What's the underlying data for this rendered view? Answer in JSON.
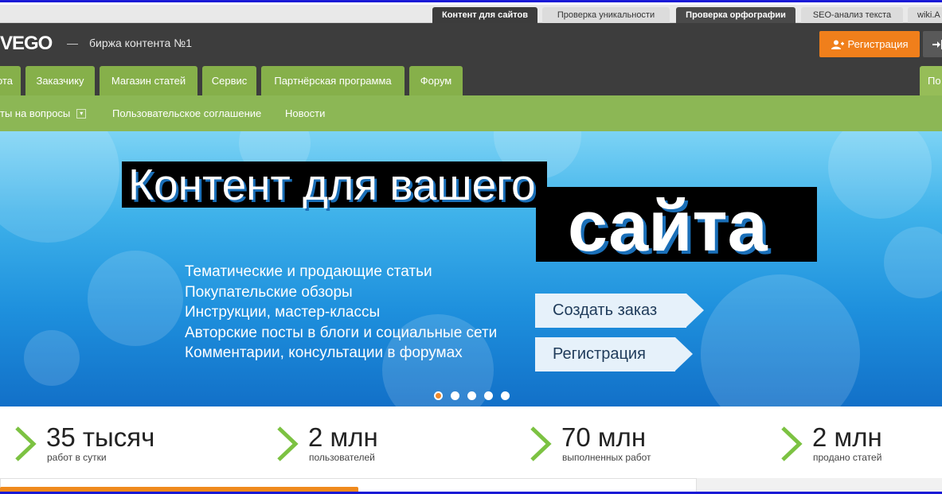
{
  "service_tabs": [
    {
      "label": "Контент для сайтов"
    },
    {
      "label": "Проверка уникальности"
    },
    {
      "label": "Проверка орфографии"
    },
    {
      "label": "SEO-анализ текста"
    },
    {
      "label": "wiki.A"
    }
  ],
  "header": {
    "logo": "VEGO",
    "separator": "—",
    "tagline": "биржа контента №1",
    "register_button": "Регистрация"
  },
  "nav": {
    "tabs": [
      {
        "label": "ота"
      },
      {
        "label": "Заказчику"
      },
      {
        "label": "Магазин статей"
      },
      {
        "label": "Сервис"
      },
      {
        "label": "Партнёрская программа"
      },
      {
        "label": "Форум"
      },
      {
        "label": "По"
      }
    ]
  },
  "subnav": {
    "items": [
      {
        "label": "ты на вопросы"
      },
      {
        "label": "Пользовательское соглашение"
      },
      {
        "label": "Новости"
      }
    ]
  },
  "hero": {
    "headline_line1": "Контент для вашего",
    "headline_line2": "сайта",
    "features": [
      "Тематические и продающие статьи",
      "Покупательские обзоры",
      "Инструкции, мастер-классы",
      "Авторские посты в блоги и социальные сети",
      "Комментарии, консультации в форумах"
    ],
    "cta_order": "Создать заказ",
    "cta_register": "Регистрация",
    "slides_total": 5,
    "slide_active": 1
  },
  "stats": [
    {
      "value": "35 тысяч",
      "label": "работ в сутки"
    },
    {
      "value": "2 млн",
      "label": "пользователей"
    },
    {
      "value": "70 млн",
      "label": "выполненных работ"
    },
    {
      "value": "2 млн",
      "label": "продано статей"
    }
  ],
  "colors": {
    "accent_orange": "#f07f1b",
    "nav_green": "#86b04a",
    "subnav_green": "#8cb755",
    "header_dark": "#3d3d3d",
    "chevron_green": "#7cc242"
  }
}
